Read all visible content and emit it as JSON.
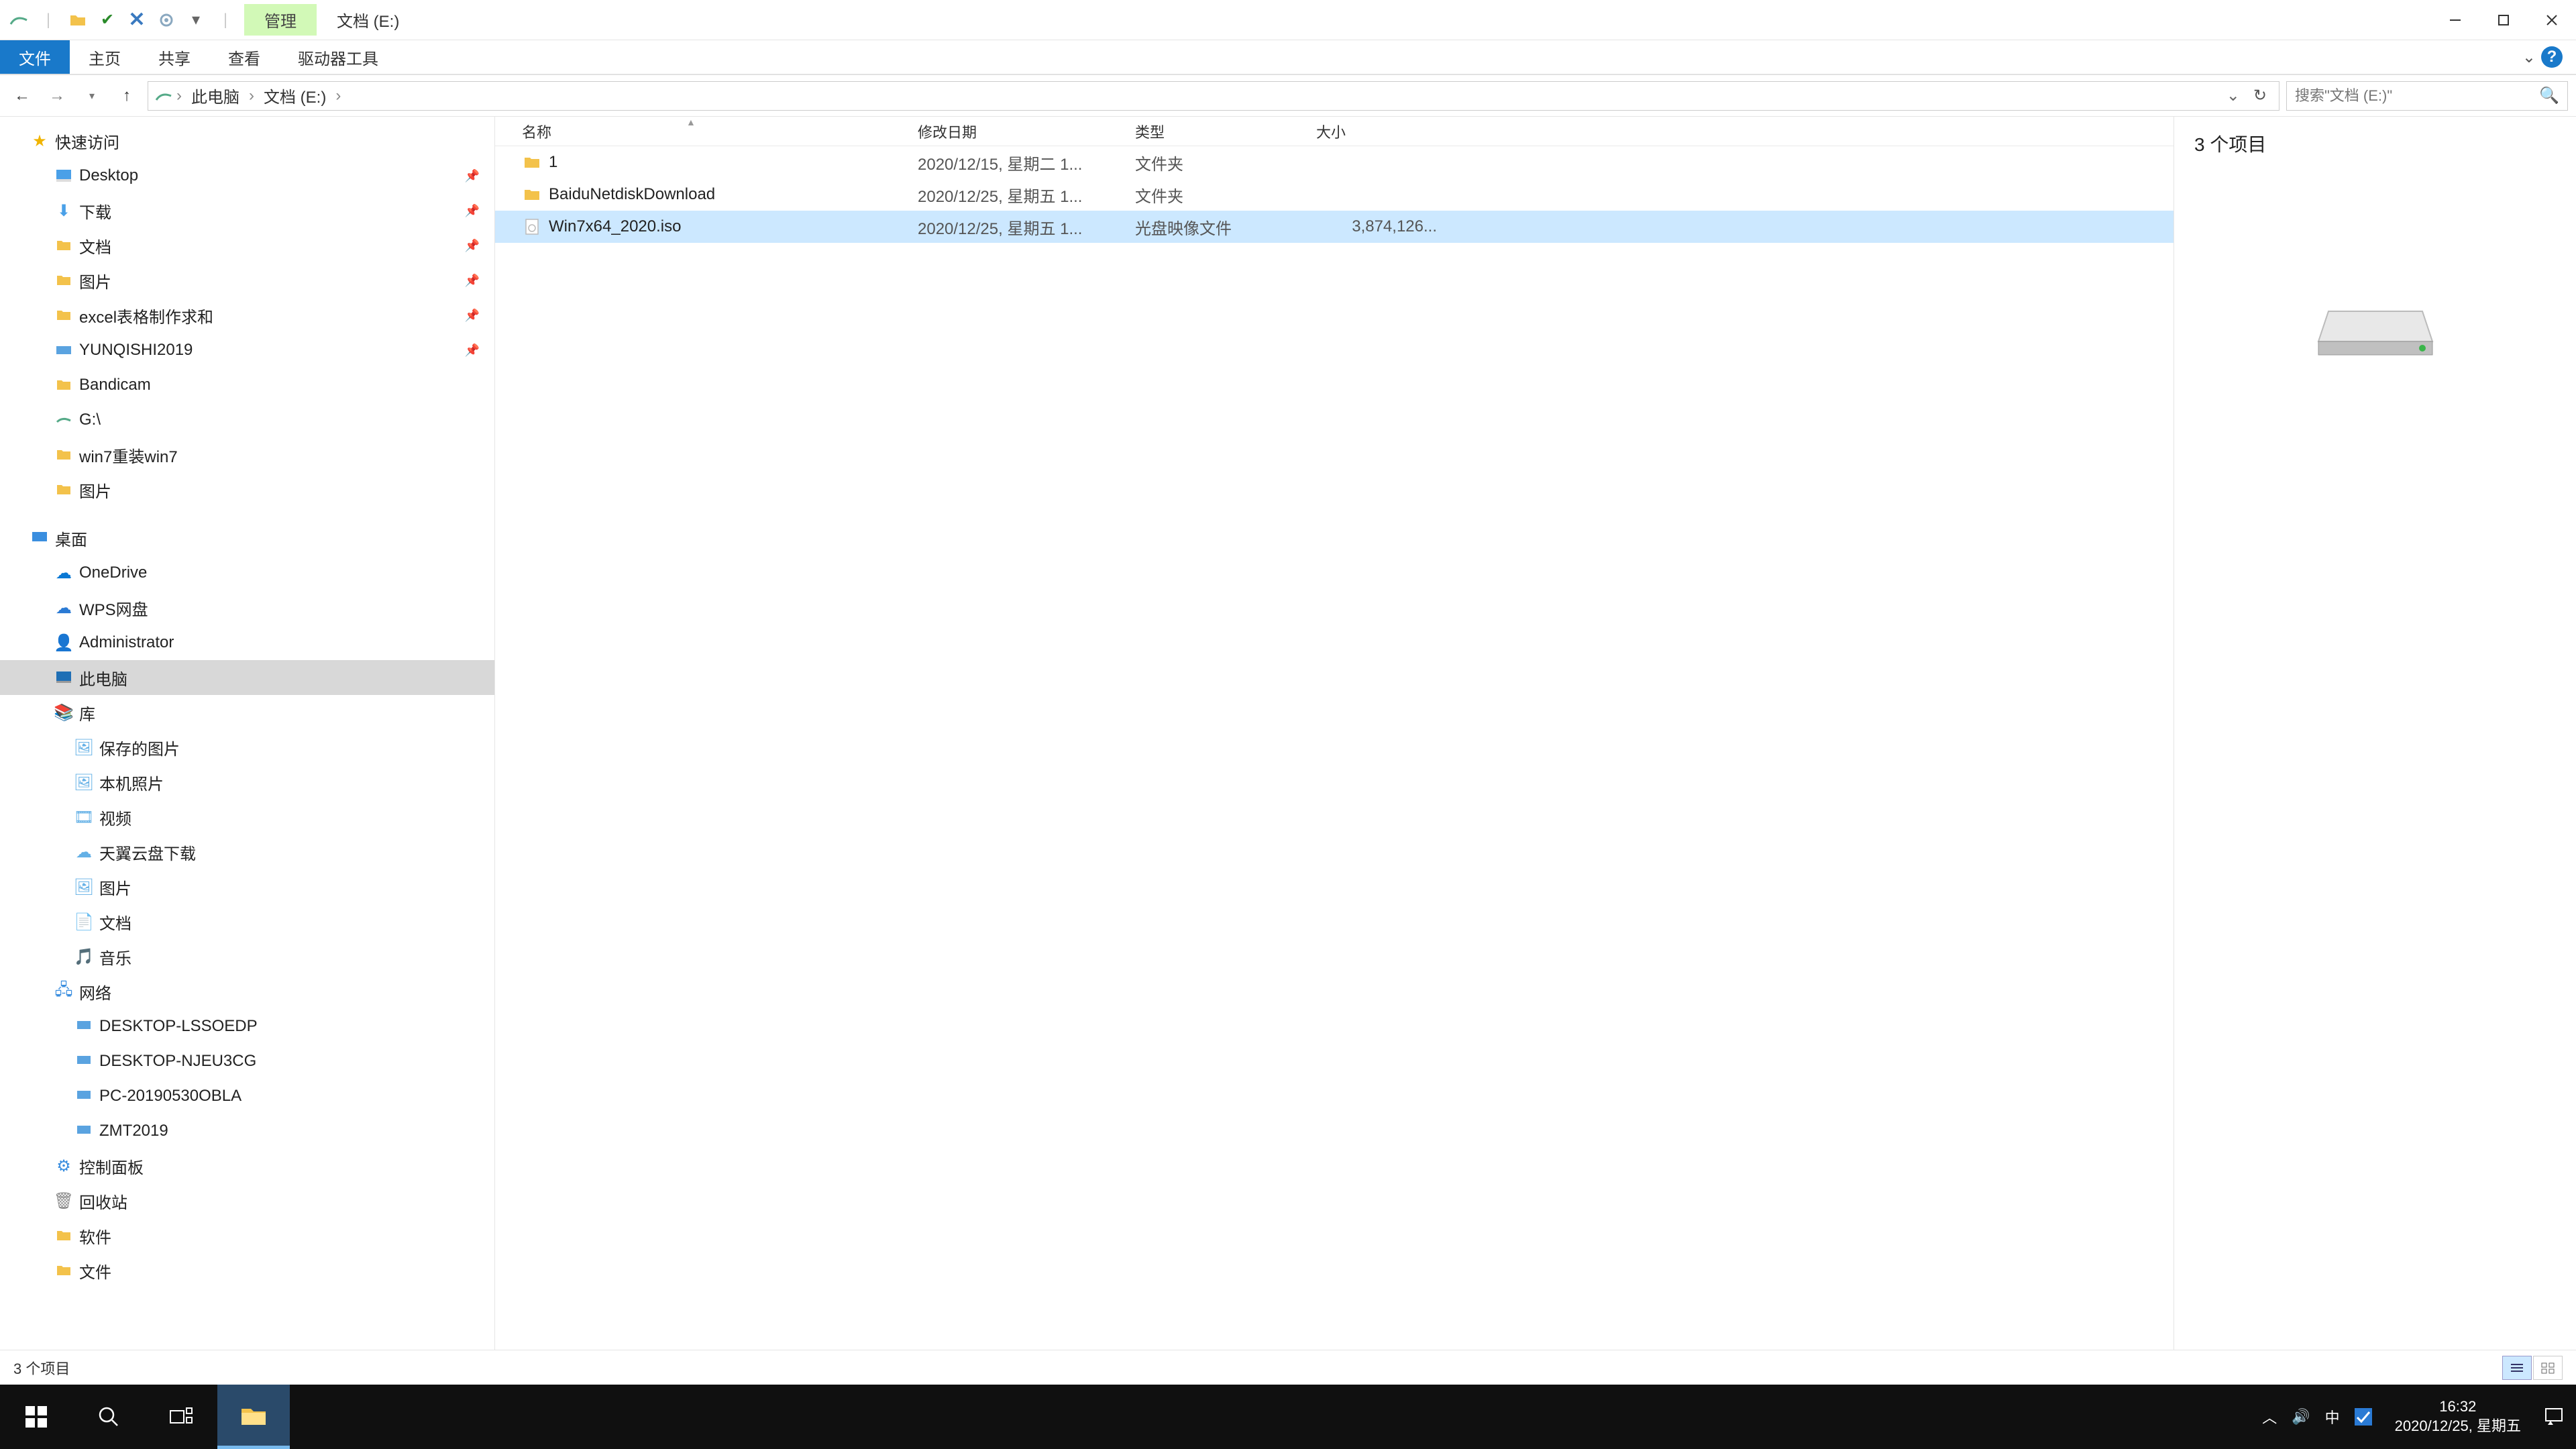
{
  "titlebar": {
    "context_tab": "管理",
    "path_label": "文档 (E:)"
  },
  "ribbon": {
    "tabs": [
      "文件",
      "主页",
      "共享",
      "查看",
      "驱动器工具"
    ],
    "active_index": 0
  },
  "address": {
    "segments": [
      "此电脑",
      "文档 (E:)"
    ],
    "search_placeholder": "搜索\"文档 (E:)\""
  },
  "nav": {
    "quick_access": "快速访问",
    "quick_items": [
      {
        "label": "Desktop",
        "pinned": true,
        "color": "#4aa0e8"
      },
      {
        "label": "下载",
        "pinned": true,
        "color": "#4aa0e8"
      },
      {
        "label": "文档",
        "pinned": true,
        "color": "#f3c24b"
      },
      {
        "label": "图片",
        "pinned": true,
        "color": "#f3c24b"
      },
      {
        "label": "excel表格制作求和",
        "pinned": true,
        "color": "#f3c24b"
      },
      {
        "label": "YUNQISHI2019",
        "pinned": true,
        "color": "#5aa3e0"
      },
      {
        "label": "Bandicam",
        "pinned": false,
        "color": "#f3c24b"
      },
      {
        "label": "G:\\",
        "pinned": false,
        "color": "#5aa3e0"
      },
      {
        "label": "win7重装win7",
        "pinned": false,
        "color": "#f3c24b"
      },
      {
        "label": "图片",
        "pinned": false,
        "color": "#f3c24b"
      }
    ],
    "desktop": "桌面",
    "desktop_items": [
      {
        "label": "OneDrive",
        "color": "#0a78d4"
      },
      {
        "label": "WPS网盘",
        "color": "#2a7ad4"
      },
      {
        "label": "Administrator",
        "color": "#e8a33a"
      },
      {
        "label": "此电脑",
        "color": "#1f6fb5",
        "selected": true
      },
      {
        "label": "库",
        "color": "#c9a24a"
      }
    ],
    "library_items": [
      {
        "label": "保存的图片",
        "color": "#63b0e6"
      },
      {
        "label": "本机照片",
        "color": "#63b0e6"
      },
      {
        "label": "视频",
        "color": "#63b0e6"
      },
      {
        "label": "天翼云盘下载",
        "color": "#63b0e6"
      },
      {
        "label": "图片",
        "color": "#63b0e6"
      },
      {
        "label": "文档",
        "color": "#63b0e6"
      },
      {
        "label": "音乐",
        "color": "#63b0e6"
      }
    ],
    "network": "网络",
    "network_items": [
      {
        "label": "DESKTOP-LSSOEDP"
      },
      {
        "label": "DESKTOP-NJEU3CG"
      },
      {
        "label": "PC-20190530OBLA"
      },
      {
        "label": "ZMT2019"
      }
    ],
    "control_panel": "控制面板",
    "recycle": "回收站",
    "software": "软件",
    "files_folder": "文件"
  },
  "columns": {
    "name": "名称",
    "date": "修改日期",
    "type": "类型",
    "size": "大小"
  },
  "files": [
    {
      "name": "1",
      "date": "2020/12/15, 星期二 1...",
      "type": "文件夹",
      "size": "",
      "icon": "folder"
    },
    {
      "name": "BaiduNetdiskDownload",
      "date": "2020/12/25, 星期五 1...",
      "type": "文件夹",
      "size": "",
      "icon": "folder"
    },
    {
      "name": "Win7x64_2020.iso",
      "date": "2020/12/25, 星期五 1...",
      "type": "光盘映像文件",
      "size": "3,874,126...",
      "icon": "iso",
      "selected": true
    }
  ],
  "preview": {
    "summary": "3 个项目"
  },
  "status": {
    "count": "3 个项目"
  },
  "tray": {
    "ime": "中",
    "time": "16:32",
    "date": "2020/12/25, 星期五"
  }
}
